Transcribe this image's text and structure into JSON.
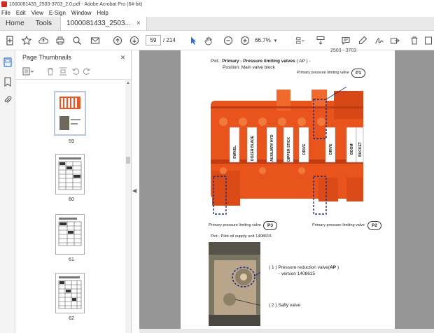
{
  "window": {
    "title": "1000081433_2503-3703_2.0.pdf - Adobe Acrobat Pro (64-bit)"
  },
  "menu": [
    "File",
    "Edit",
    "View",
    "E-Sign",
    "Window",
    "Help"
  ],
  "tabs": {
    "home": "Home",
    "tools": "Tools",
    "document": "1000081433_2503...",
    "close": "×"
  },
  "toolbar": {
    "page_current": "59",
    "page_total": "/ 214",
    "zoom": "66.7%"
  },
  "panel": {
    "title": "Page Thumbnails",
    "close": "×",
    "thumbnails": [
      {
        "label": "59",
        "selected": true
      },
      {
        "label": "60",
        "selected": false
      },
      {
        "label": "61",
        "selected": false
      },
      {
        "label": "62",
        "selected": false
      }
    ]
  },
  "page": {
    "running_head": "2503 - 3703",
    "pict_prefix": "Pict.:",
    "pict_title": "Primary - Pressure limiting valves",
    "pict_suffix": " ( AP ) -",
    "position": "Position:    Main valve block",
    "label_p1": "Primary pressure limiting valve",
    "badge_p1": "P1",
    "sections": [
      "SWIVEL",
      "DOZER BLADE",
      "AUXILIARY HYD",
      "DIPPER STICK",
      "DRIVE",
      "DRIVE",
      "BOOM",
      "BUCKET"
    ],
    "label_p3": "Primary pressure limiting valve",
    "badge_p3": "P3",
    "label_p2": "Primary pressure limiting valve",
    "badge_p2": "P2",
    "pilot_unit": "Pict.:   Pilot oil supply unit 1408615",
    "pressure_reduction_1": "( 1 )  Pressure reduction valve(",
    "pressure_reduction_bold": "AP",
    "pressure_reduction_2": " )",
    "version": "- version 1408615",
    "safety_valve": "( 2 )  Safty valve"
  },
  "colors": {
    "valve_orange": "#e8541c",
    "accent_blue": "#2a6fd6",
    "dash_navy": "#1f2a78"
  }
}
